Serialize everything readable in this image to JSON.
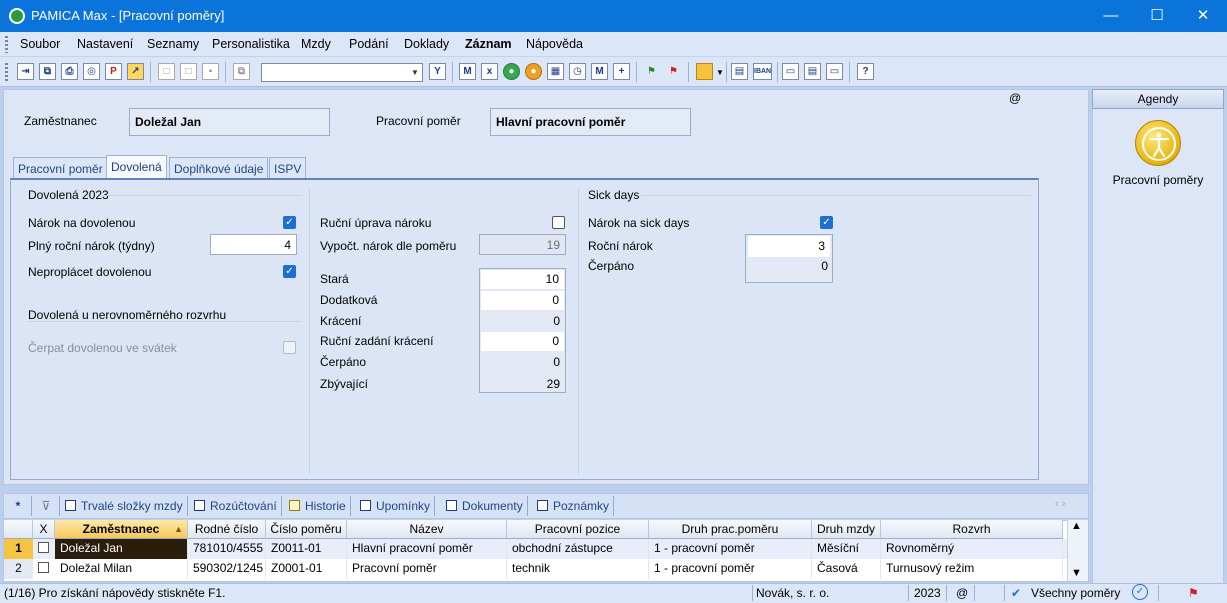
{
  "window": {
    "title": "PAMICA Max - [Pracovní poměry]",
    "min": "—",
    "max": "☐",
    "close": "✕"
  },
  "menu": [
    "Soubor",
    "Nastavení",
    "Seznamy",
    "Personalistika",
    "Mzdy",
    "Podání",
    "Doklady",
    "Záznam",
    "Nápověda"
  ],
  "toolbar": {
    "combo_value": "",
    "icons": [
      "exit-icon",
      "copy-icon",
      "print-icon",
      "preview-icon",
      "pdf-icon",
      "export-icon",
      "new-icon",
      "edit-icon",
      "save-icon",
      "delete-icon",
      "clipboard-icon",
      "filter-icon",
      "m-icon",
      "ix-icon",
      "person-green-icon",
      "person-orange-icon",
      "calendar-icon",
      "clock-icon",
      "m2-icon",
      "add-icon",
      "flag-green-icon",
      "flag-red-icon",
      "folder-icon",
      "calc-icon",
      "iban-icon",
      "monitor-icon",
      "window-icon",
      "screen-icon",
      "help-icon"
    ],
    "iban_label": "IBAN"
  },
  "header": {
    "employee_label": "Zaměstnanec",
    "employee_value": "Doležal Jan",
    "relation_label": "Pracovní poměr",
    "relation_value": "Hlavní pracovní poměr",
    "at_symbol": "@"
  },
  "tabs": [
    "Pracovní poměr",
    "Dovolená",
    "Doplňkové údaje",
    "ISPV"
  ],
  "vacation": {
    "group_title": "Dovolená 2023",
    "entitlement_label": "Nárok na dovolenou",
    "entitlement_checked": true,
    "full_annual_label": "Plný roční nárok (týdny)",
    "full_annual_value": "4",
    "no_pay_label": "Neproplácet dovolenou",
    "no_pay_checked": true,
    "uneven_title": "Dovolená u nerovnoměrného rozvrhu",
    "holiday_label": "Čerpat dovolenou ve svátek",
    "holiday_checked": false
  },
  "middle": {
    "manual_label": "Ruční úprava nároku",
    "manual_checked": false,
    "calc_label": "Vypočt. nárok dle poměru",
    "calc_value": "19",
    "rows": [
      {
        "label": "Stará",
        "value": "10",
        "editable": true
      },
      {
        "label": "Dodatková",
        "value": "0",
        "editable": true
      },
      {
        "label": "Krácení",
        "value": "0",
        "editable": false
      },
      {
        "label": "Ruční zadání krácení",
        "value": "0",
        "editable": true
      },
      {
        "label": "Čerpáno",
        "value": "0",
        "editable": false
      },
      {
        "label": "Zbývající",
        "value": "29",
        "editable": false
      }
    ]
  },
  "sick": {
    "group_title": "Sick days",
    "entitlement_label": "Nárok na sick days",
    "entitlement_checked": true,
    "annual_label": "Roční nárok",
    "annual_value": "3",
    "used_label": "Čerpáno",
    "used_value": "0"
  },
  "agendy": {
    "header": "Agendy",
    "item_label": "Pracovní poměry"
  },
  "bottom_tabs": {
    "star": "*",
    "items": [
      "Trvalé složky mzdy",
      "Rozúčtování",
      "Historie",
      "Upomínky",
      "Dokumenty",
      "Poznámky"
    ],
    "nav": "‹ ›"
  },
  "grid": {
    "columns": [
      "X",
      "Zaměstnanec",
      "Rodné číslo",
      "Číslo poměru",
      "Název",
      "Pracovní pozice",
      "Druh prac.poměru",
      "Druh mzdy",
      "Rozvrh"
    ],
    "rows": [
      {
        "n": "1",
        "employee": "Doležal Jan",
        "birth": "781010/4555",
        "number": "Z0011-01",
        "name": "Hlavní pracovní poměr",
        "position": "obchodní zástupce",
        "type": "1 - pracovní poměr",
        "wage": "Měsíční",
        "schedule": "Rovnoměrný"
      },
      {
        "n": "2",
        "employee": "Doležal Milan",
        "birth": "590302/1245",
        "number": "Z0001-01",
        "name": "Pracovní poměr",
        "position": "technik",
        "type": "1 - pracovní poměr",
        "wage": "Časová",
        "schedule": "Turnusový režim"
      }
    ]
  },
  "status": {
    "help": "(1/16) Pro získání nápovědy stiskněte F1.",
    "company": "Novák, s. r. o.",
    "year": "2023",
    "at": "@",
    "filter": "Všechny poměry"
  },
  "colors": {
    "titlebar": "#0a74da",
    "selected_row": "#2a1d0c",
    "accent": "#1f6fd0"
  }
}
